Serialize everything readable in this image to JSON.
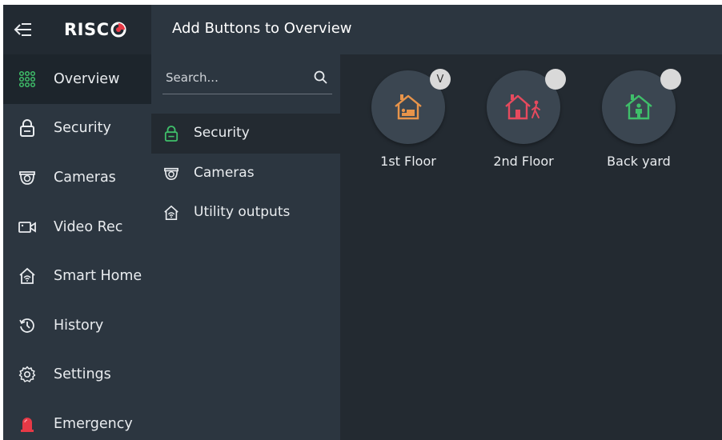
{
  "brand": {
    "logo_text": "RISC"
  },
  "header": {
    "title": "Add Buttons to Overview"
  },
  "sidebar": {
    "items": [
      {
        "label": "Overview",
        "icon": "grid-dots-icon",
        "active": true
      },
      {
        "label": "Security",
        "icon": "padlock-icon"
      },
      {
        "label": "Cameras",
        "icon": "camera-icon"
      },
      {
        "label": "Video Rec",
        "icon": "video-recorder-icon"
      },
      {
        "label": "Smart Home",
        "icon": "smart-home-icon"
      },
      {
        "label": "History",
        "icon": "history-icon"
      },
      {
        "label": "Settings",
        "icon": "gear-icon"
      },
      {
        "label": "Emergency",
        "icon": "siren-icon"
      }
    ]
  },
  "search": {
    "placeholder": "Search..."
  },
  "categories": [
    {
      "label": "Security",
      "icon": "padlock-icon",
      "active": true
    },
    {
      "label": "Cameras",
      "icon": "camera-icon"
    },
    {
      "label": "Utility outputs",
      "icon": "smart-home-icon"
    }
  ],
  "tiles": [
    {
      "name": "1st Floor",
      "badge": "V",
      "color": "#e8944a"
    },
    {
      "name": "2nd Floor",
      "badge": "",
      "color": "#e64a5e"
    },
    {
      "name": "Back yard",
      "badge": "",
      "color": "#3fbf6a"
    }
  ],
  "colors": {
    "accent_green": "#3fbf6a",
    "accent_red": "#e63946",
    "background": "#232a31",
    "panel": "#2c3640"
  }
}
